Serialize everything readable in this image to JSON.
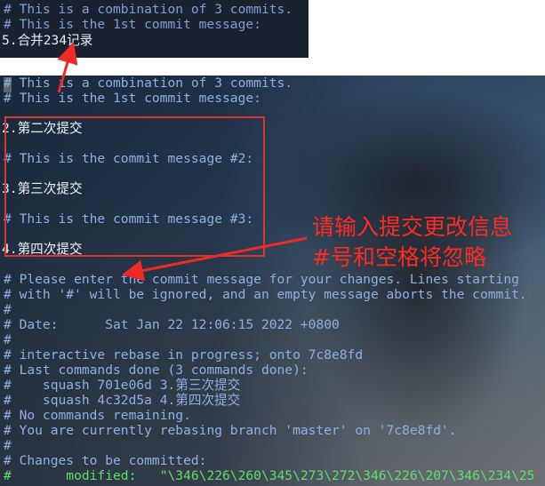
{
  "top_snippet": {
    "lines": [
      {
        "text": "# This is a combination of 3 commits.",
        "kind": "comment"
      },
      {
        "text": "# This is the 1st commit message:",
        "kind": "comment"
      },
      {
        "text": "5.合并234记录",
        "kind": "text"
      }
    ]
  },
  "main_terminal": {
    "lines": [
      {
        "text": "# This is a combination of 3 commits.",
        "kind": "comment"
      },
      {
        "text": "# This is the 1st commit message:",
        "kind": "comment"
      },
      {
        "text": "",
        "kind": "text"
      },
      {
        "text": "2.第二次提交",
        "kind": "text"
      },
      {
        "text": "",
        "kind": "text"
      },
      {
        "text": "# This is the commit message #2:",
        "kind": "comment"
      },
      {
        "text": "",
        "kind": "text"
      },
      {
        "text": "3.第三次提交",
        "kind": "text"
      },
      {
        "text": "",
        "kind": "text"
      },
      {
        "text": "# This is the commit message #3:",
        "kind": "comment"
      },
      {
        "text": "",
        "kind": "text"
      },
      {
        "text": "4.第四次提交",
        "kind": "text"
      },
      {
        "text": "",
        "kind": "text"
      },
      {
        "text": "# Please enter the commit message for your changes. Lines starting",
        "kind": "comment"
      },
      {
        "text": "# with '#' will be ignored, and an empty message aborts the commit.",
        "kind": "comment"
      },
      {
        "text": "#",
        "kind": "comment"
      },
      {
        "text": "# Date:      Sat Jan 22 12:06:15 2022 +0800",
        "kind": "comment"
      },
      {
        "text": "#",
        "kind": "comment"
      },
      {
        "text": "# interactive rebase in progress; onto 7c8e8fd",
        "kind": "comment"
      },
      {
        "text": "# Last commands done (3 commands done):",
        "kind": "comment"
      },
      {
        "text": "#    squash 701e06d 3.第三次提交",
        "kind": "comment"
      },
      {
        "text": "#    squash 4c32d5a 4.第四次提交",
        "kind": "comment"
      },
      {
        "text": "# No commands remaining.",
        "kind": "comment"
      },
      {
        "text": "# You are currently rebasing branch 'master' on '7c8e8fd'.",
        "kind": "comment"
      },
      {
        "text": "#",
        "kind": "comment"
      },
      {
        "text": "# Changes to be committed:",
        "kind": "comment"
      },
      {
        "text": "#       modified:   \"\\346\\226\\260\\345\\273\\272\\346\\226\\207\\346\\234\\25",
        "kind": "modified"
      }
    ]
  },
  "annotations": {
    "line1": "请输入提交更改信息",
    "line2": "#号和空格将忽略"
  },
  "colors": {
    "annotation_red": "#ff2a24",
    "comment_blue": "#8fb0e6",
    "modified_green": "#5ee06a"
  }
}
